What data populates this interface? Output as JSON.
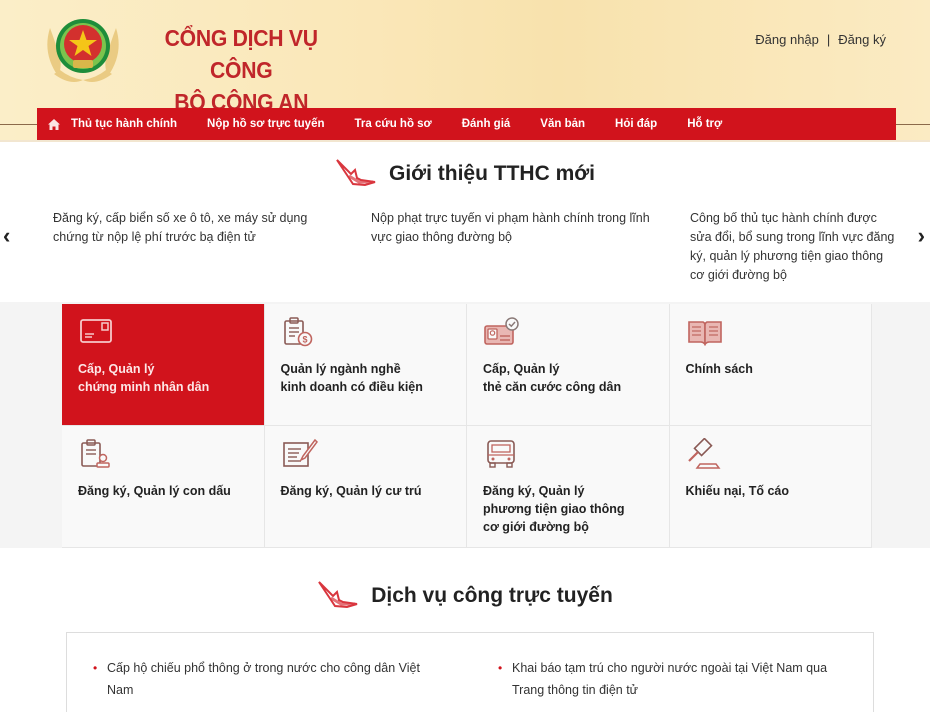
{
  "header": {
    "logo": "cong-an-emblem",
    "title_line1": "CỔNG DỊCH VỤ CÔNG",
    "title_line2": "BỘ CÔNG AN",
    "login": "Đăng nhập",
    "separator": "|",
    "register": "Đăng ký"
  },
  "nav": {
    "home_icon": "home-icon",
    "items": [
      {
        "label": "Thủ tục hành chính"
      },
      {
        "label": "Nộp hồ sơ trực tuyến"
      },
      {
        "label": "Tra cứu hồ sơ"
      },
      {
        "label": "Đánh giá"
      },
      {
        "label": "Văn bản"
      },
      {
        "label": "Hỏi đáp"
      },
      {
        "label": "Hỗ trợ"
      }
    ]
  },
  "intro": {
    "title": "Giới thiệu TTHC mới",
    "prev": "‹",
    "next": "›",
    "items": [
      {
        "text": "Đăng ký, cấp biển số xe ô tô, xe máy sử dụng chứng từ nộp lệ phí trước bạ điện tử"
      },
      {
        "text": "Nộp phạt trực tuyến vi phạm hành chính trong lĩnh vực giao thông đường bộ"
      },
      {
        "text": "Công bố thủ tục hành chính được sửa đổi, bổ sung trong lĩnh vực đăng ký, quản lý phương tiện giao thông cơ giới đường bộ"
      }
    ]
  },
  "categories": [
    {
      "label": "Cấp, Quản lý\nchứng minh nhân dân",
      "icon": "id-card-icon",
      "active": true
    },
    {
      "label": "Quản lý ngành nghề\nkinh doanh có điều kiện",
      "icon": "clipboard-dollar-icon",
      "active": false
    },
    {
      "label": "Cấp, Quản lý\nthẻ căn cước công dân",
      "icon": "id-card-check-icon",
      "active": false
    },
    {
      "label": "Chính sách",
      "icon": "book-icon",
      "active": false
    },
    {
      "label": "Đăng ký, Quản lý con dấu",
      "icon": "clipboard-stamp-icon",
      "active": false
    },
    {
      "label": "Đăng ký, Quản lý cư trú",
      "icon": "document-pen-icon",
      "active": false
    },
    {
      "label": "Đăng ký, Quản lý\nphương tiện giao thông\ncơ giới đường bộ",
      "icon": "car-icon",
      "active": false
    },
    {
      "label": "Khiếu nại, Tố cáo",
      "icon": "gavel-icon",
      "active": false
    }
  ],
  "online": {
    "title": "Dịch vụ công trực tuyến",
    "services": [
      {
        "text": "Cấp hộ chiếu phổ thông ở trong nước cho công dân Việt Nam"
      },
      {
        "text": "Khai báo tạm trú cho người nước ngoài tại Việt Nam qua Trang thông tin điện tử"
      }
    ]
  },
  "colors": {
    "brand_red": "#d1131c",
    "title_red": "#c0262a",
    "header_bg": "#fae7b8",
    "icon_rose": "#c0655f"
  }
}
